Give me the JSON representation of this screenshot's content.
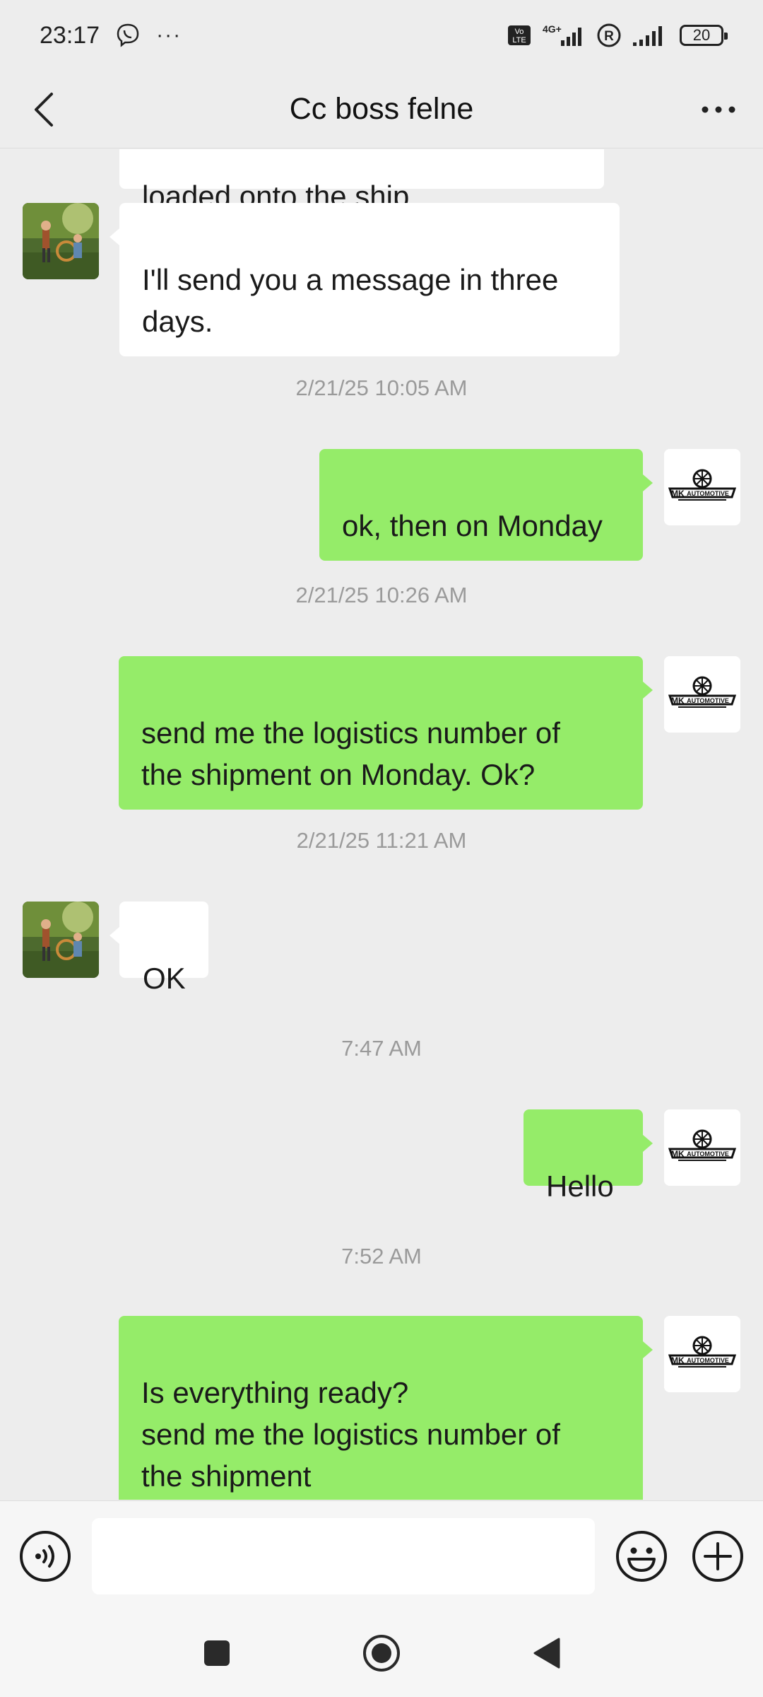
{
  "status_bar": {
    "time": "23:17",
    "dots": "···",
    "battery": "20",
    "network": "4G+"
  },
  "header": {
    "title": "Cc boss felne"
  },
  "messages": [
    {
      "type": "in",
      "text": "loaded onto the ship"
    },
    {
      "type": "in",
      "text": "I'll send you a message in three\ndays."
    },
    {
      "type": "time",
      "text": "2/21/25 10:05 AM"
    },
    {
      "type": "out",
      "text": "ok, then on Monday"
    },
    {
      "type": "time",
      "text": "2/21/25 10:26 AM"
    },
    {
      "type": "out",
      "text": "send me the logistics number of\nthe shipment on Monday. Ok?"
    },
    {
      "type": "time",
      "text": "2/21/25 11:21 AM"
    },
    {
      "type": "in",
      "text": "OK"
    },
    {
      "type": "time",
      "text": "7:47 AM"
    },
    {
      "type": "out",
      "text": "Hello"
    },
    {
      "type": "time",
      "text": "7:52 AM"
    },
    {
      "type": "out",
      "text": "Is everything ready?\nsend me the logistics number of\nthe shipment"
    }
  ],
  "avatar_logo_text": "AUTOMOTIVE",
  "input": {
    "value": "",
    "placeholder": ""
  },
  "colors": {
    "outgoing_bubble": "#95ec69",
    "incoming_bubble": "#ffffff",
    "background": "#ededed"
  }
}
